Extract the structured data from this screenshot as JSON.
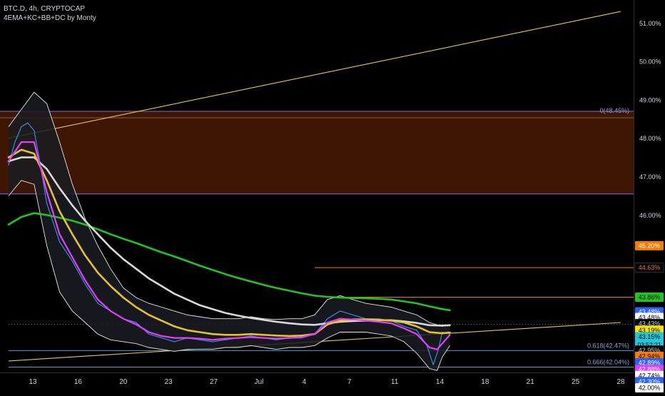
{
  "header": {
    "symbol_line": "BTC.D, 4h, CRYPTOCAP",
    "indicator_line": "4EMA+KC+BB+DC by Monty"
  },
  "colors": {
    "background": "#000000",
    "axis_text": "#d1d4dc",
    "ema_green": "#22c41e",
    "ema_white": "#d8d8d8",
    "ema_yellow": "#e6c229",
    "ema_magenta": "#e040fb",
    "trendline": "#e6c74a",
    "zone_fill": "#4a1a05",
    "zone_border": "#7c5cc4",
    "fib_line": "#5b9bd5",
    "orange_level": "#f57c00"
  },
  "chart_data": {
    "type": "line",
    "title": "BTC.D, 4h, CRYPTOCAP",
    "x_ticks": [
      "13",
      "16",
      "20",
      "23",
      "27",
      "Jul",
      "4",
      "7",
      "11",
      "14",
      "18",
      "21",
      "25",
      "28"
    ],
    "y_ticks": [
      "51.00%",
      "50.00%",
      "49.00%",
      "48.00%",
      "47.00%",
      "46.00%"
    ],
    "ylim": [
      41.9,
      51.6
    ],
    "y_unit": "%",
    "x_range_days": [
      0,
      48
    ],
    "series": [
      {
        "role": "price",
        "points": [
          [
            0,
            47.3
          ],
          [
            0.5,
            47.9
          ],
          [
            1,
            48.3
          ],
          [
            1.5,
            48.4
          ],
          [
            2,
            48.2
          ],
          [
            2.5,
            47.3
          ],
          [
            3,
            46.3
          ],
          [
            3.5,
            45.8
          ],
          [
            4,
            45.3
          ],
          [
            5,
            44.8
          ],
          [
            6,
            44.2
          ],
          [
            7,
            43.7
          ],
          [
            8,
            43.5
          ],
          [
            9,
            43.3
          ],
          [
            10,
            43.2
          ],
          [
            11,
            42.9
          ],
          [
            12,
            42.8
          ],
          [
            13,
            42.7
          ],
          [
            14,
            42.8
          ],
          [
            15,
            42.75
          ],
          [
            16,
            42.7
          ],
          [
            17,
            42.75
          ],
          [
            18,
            42.8
          ],
          [
            19,
            42.85
          ],
          [
            20,
            42.8
          ],
          [
            21,
            42.75
          ],
          [
            22,
            42.8
          ],
          [
            23,
            42.8
          ],
          [
            24,
            42.9
          ],
          [
            25,
            43.3
          ],
          [
            26,
            43.5
          ],
          [
            27,
            43.4
          ],
          [
            28,
            43.3
          ],
          [
            29,
            43.3
          ],
          [
            30,
            43.25
          ],
          [
            31,
            43.1
          ],
          [
            32,
            43.0
          ],
          [
            32.8,
            42.6
          ],
          [
            33.3,
            42.1
          ],
          [
            33.7,
            42.5
          ],
          [
            34,
            42.95
          ],
          [
            34.6,
            42.9
          ]
        ]
      },
      {
        "role": "ema-magenta",
        "points": [
          [
            0,
            47.4
          ],
          [
            1,
            47.9
          ],
          [
            2,
            47.9
          ],
          [
            3,
            46.6
          ],
          [
            4,
            45.5
          ],
          [
            5,
            44.9
          ],
          [
            6,
            44.3
          ],
          [
            7,
            43.8
          ],
          [
            8,
            43.5
          ],
          [
            9,
            43.3
          ],
          [
            10,
            43.15
          ],
          [
            11,
            42.95
          ],
          [
            12,
            42.85
          ],
          [
            13,
            42.8
          ],
          [
            14,
            42.8
          ],
          [
            15,
            42.78
          ],
          [
            16,
            42.75
          ],
          [
            17,
            42.78
          ],
          [
            18,
            42.8
          ],
          [
            19,
            42.82
          ],
          [
            20,
            42.8
          ],
          [
            21,
            42.78
          ],
          [
            22,
            42.8
          ],
          [
            23,
            42.82
          ],
          [
            24,
            42.9
          ],
          [
            25,
            43.2
          ],
          [
            26,
            43.3
          ],
          [
            27,
            43.28
          ],
          [
            28,
            43.25
          ],
          [
            29,
            43.22
          ],
          [
            30,
            43.18
          ],
          [
            31,
            43.05
          ],
          [
            32,
            42.9
          ],
          [
            33,
            42.55
          ],
          [
            33.6,
            42.5
          ],
          [
            34.6,
            42.88
          ]
        ]
      },
      {
        "role": "ema-yellow",
        "points": [
          [
            0,
            47.5
          ],
          [
            1,
            47.7
          ],
          [
            2,
            47.6
          ],
          [
            3,
            46.9
          ],
          [
            4,
            46.1
          ],
          [
            5,
            45.5
          ],
          [
            6,
            44.95
          ],
          [
            7,
            44.5
          ],
          [
            8,
            44.15
          ],
          [
            9,
            43.85
          ],
          [
            10,
            43.6
          ],
          [
            11,
            43.4
          ],
          [
            12,
            43.25
          ],
          [
            13,
            43.1
          ],
          [
            14,
            43.0
          ],
          [
            15,
            42.95
          ],
          [
            16,
            42.9
          ],
          [
            17,
            42.88
          ],
          [
            18,
            42.88
          ],
          [
            19,
            42.9
          ],
          [
            20,
            42.88
          ],
          [
            21,
            42.86
          ],
          [
            22,
            42.85
          ],
          [
            23,
            42.86
          ],
          [
            24,
            42.9
          ],
          [
            25,
            43.15
          ],
          [
            26,
            43.25
          ],
          [
            27,
            43.28
          ],
          [
            28,
            43.28
          ],
          [
            29,
            43.27
          ],
          [
            30,
            43.25
          ],
          [
            31,
            43.2
          ],
          [
            32,
            43.1
          ],
          [
            33,
            42.95
          ],
          [
            34,
            42.92
          ],
          [
            34.6,
            42.94
          ]
        ]
      },
      {
        "role": "ema-white",
        "points": [
          [
            0,
            47.4
          ],
          [
            1,
            47.5
          ],
          [
            2,
            47.5
          ],
          [
            3,
            47.2
          ],
          [
            4,
            46.7
          ],
          [
            5,
            46.25
          ],
          [
            6,
            45.85
          ],
          [
            7,
            45.5
          ],
          [
            8,
            45.15
          ],
          [
            9,
            44.85
          ],
          [
            10,
            44.6
          ],
          [
            11,
            44.35
          ],
          [
            12,
            44.15
          ],
          [
            13,
            43.95
          ],
          [
            14,
            43.8
          ],
          [
            15,
            43.65
          ],
          [
            16,
            43.55
          ],
          [
            17,
            43.45
          ],
          [
            18,
            43.38
          ],
          [
            19,
            43.32
          ],
          [
            20,
            43.27
          ],
          [
            21,
            43.22
          ],
          [
            22,
            43.18
          ],
          [
            23,
            43.15
          ],
          [
            24,
            43.14
          ],
          [
            25,
            43.18
          ],
          [
            26,
            43.22
          ],
          [
            27,
            43.24
          ],
          [
            28,
            43.25
          ],
          [
            29,
            43.26
          ],
          [
            30,
            43.26
          ],
          [
            31,
            43.23
          ],
          [
            32,
            43.19
          ],
          [
            33,
            43.13
          ],
          [
            34,
            43.12
          ],
          [
            34.6,
            43.13
          ]
        ]
      },
      {
        "role": "ema-green",
        "points": [
          [
            0,
            45.75
          ],
          [
            1,
            45.95
          ],
          [
            2,
            46.05
          ],
          [
            3,
            46.0
          ],
          [
            4,
            45.93
          ],
          [
            5,
            45.85
          ],
          [
            6,
            45.75
          ],
          [
            7,
            45.63
          ],
          [
            8,
            45.5
          ],
          [
            9,
            45.38
          ],
          [
            10,
            45.27
          ],
          [
            11,
            45.15
          ],
          [
            12,
            45.03
          ],
          [
            13,
            44.92
          ],
          [
            14,
            44.8
          ],
          [
            15,
            44.68
          ],
          [
            16,
            44.57
          ],
          [
            17,
            44.46
          ],
          [
            18,
            44.36
          ],
          [
            19,
            44.27
          ],
          [
            20,
            44.18
          ],
          [
            21,
            44.1
          ],
          [
            22,
            44.03
          ],
          [
            23,
            43.96
          ],
          [
            24,
            43.9
          ],
          [
            25,
            43.87
          ],
          [
            26,
            43.85
          ],
          [
            27,
            43.84
          ],
          [
            28,
            43.83
          ],
          [
            29,
            43.82
          ],
          [
            30,
            43.8
          ],
          [
            31,
            43.75
          ],
          [
            32,
            43.7
          ],
          [
            33,
            43.62
          ],
          [
            34,
            43.55
          ],
          [
            34.6,
            43.52
          ]
        ]
      },
      {
        "role": "bb-upper",
        "points": [
          [
            0,
            48.3
          ],
          [
            1,
            48.75
          ],
          [
            2,
            49.2
          ],
          [
            3,
            48.9
          ],
          [
            4,
            47.9
          ],
          [
            5,
            46.8
          ],
          [
            6,
            45.9
          ],
          [
            7,
            45.2
          ],
          [
            8,
            44.6
          ],
          [
            9,
            44.1
          ],
          [
            10,
            43.85
          ],
          [
            11,
            43.7
          ],
          [
            12,
            43.6
          ],
          [
            13,
            43.5
          ],
          [
            14,
            43.4
          ],
          [
            15,
            43.35
          ],
          [
            16,
            43.3
          ],
          [
            17,
            43.3
          ],
          [
            18,
            43.3
          ],
          [
            19,
            43.35
          ],
          [
            20,
            43.3
          ],
          [
            21,
            43.28
          ],
          [
            22,
            43.3
          ],
          [
            23,
            43.3
          ],
          [
            24,
            43.4
          ],
          [
            25,
            43.8
          ],
          [
            26,
            43.9
          ],
          [
            27,
            43.8
          ],
          [
            28,
            43.7
          ],
          [
            29,
            43.65
          ],
          [
            30,
            43.6
          ],
          [
            31,
            43.5
          ],
          [
            32,
            43.4
          ],
          [
            33,
            43.2
          ],
          [
            34,
            43.1
          ],
          [
            34.6,
            43.15
          ]
        ]
      },
      {
        "role": "bb-lower",
        "points": [
          [
            0,
            46.5
          ],
          [
            1,
            46.9
          ],
          [
            2,
            46.8
          ],
          [
            3,
            45.2
          ],
          [
            4,
            44.0
          ],
          [
            5,
            43.5
          ],
          [
            6,
            43.2
          ],
          [
            7,
            42.9
          ],
          [
            8,
            42.75
          ],
          [
            9,
            42.7
          ],
          [
            10,
            42.65
          ],
          [
            11,
            42.55
          ],
          [
            12,
            42.5
          ],
          [
            13,
            42.45
          ],
          [
            14,
            42.5
          ],
          [
            15,
            42.5
          ],
          [
            16,
            42.5
          ],
          [
            17,
            42.55
          ],
          [
            18,
            42.55
          ],
          [
            19,
            42.6
          ],
          [
            20,
            42.55
          ],
          [
            21,
            42.5
          ],
          [
            22,
            42.55
          ],
          [
            23,
            42.55
          ],
          [
            24,
            42.6
          ],
          [
            25,
            42.8
          ],
          [
            26,
            42.95
          ],
          [
            27,
            42.95
          ],
          [
            28,
            42.95
          ],
          [
            29,
            42.9
          ],
          [
            30,
            42.85
          ],
          [
            31,
            42.7
          ],
          [
            32,
            42.4
          ],
          [
            33,
            42.0
          ],
          [
            33.6,
            41.95
          ],
          [
            34,
            42.3
          ],
          [
            34.6,
            42.6
          ]
        ]
      }
    ],
    "zone": {
      "top": 48.7,
      "bottom": 46.55,
      "label": "0(48.45%)"
    },
    "trendlines": [
      {
        "points": [
          [
            0,
            48.0
          ],
          [
            48,
            51.3
          ]
        ]
      },
      {
        "points": [
          [
            0,
            42.2
          ],
          [
            48,
            43.2
          ]
        ]
      }
    ],
    "horizontal_levels": [
      {
        "value": 44.63,
        "x_start": 24,
        "style": "orange"
      },
      {
        "value": 43.86,
        "x_start": 25,
        "style": "orange"
      },
      {
        "value": 42.47,
        "x_start": 0,
        "style": "fib",
        "label": "0.618(42.47%)"
      },
      {
        "value": 42.04,
        "x_start": 0,
        "style": "fib",
        "label": "0.666(42.04%)"
      },
      {
        "value": 43.15,
        "x_start": 0,
        "style": "dotted"
      }
    ],
    "price_badges": [
      {
        "text": "45.20%",
        "value": 45.2,
        "bg": "#f57c00",
        "fg": "#ffffff"
      },
      {
        "text": "44.63%",
        "value": 44.63,
        "bg": "#000000",
        "fg": "#f57c00"
      },
      {
        "text": "43.86%",
        "value": 43.86,
        "bg": "#22c41e",
        "fg": "#000000"
      },
      {
        "text": "43.48%",
        "value": 43.48,
        "bg": "#2962ff",
        "fg": "#ffffff"
      },
      {
        "text": "43.48%",
        "value": 43.33,
        "bg": "#ffffff",
        "fg": "#000000"
      },
      {
        "text": "43.43%",
        "value": 43.17,
        "bg": "#000000",
        "fg": "#d1d4dc"
      },
      {
        "text": "43.19%",
        "value": 43.0,
        "bg": "#f5e400",
        "fg": "#000000"
      },
      {
        "text": "43.15%",
        "value": 42.83,
        "bg": "#26c6da",
        "fg": "#000000",
        "sub": "03:52:21"
      },
      {
        "text": "42.95%",
        "value": 42.48,
        "bg": "#000000",
        "fg": "#d1d4dc"
      },
      {
        "text": "42.94%",
        "value": 42.32,
        "bg": "#f57c00",
        "fg": "#000000"
      },
      {
        "text": "42.89%",
        "value": 42.15,
        "bg": "#2962ff",
        "fg": "#ffffff"
      },
      {
        "text": "42.88%",
        "value": 41.98,
        "bg": "#e040fb",
        "fg": "#ffffff"
      },
      {
        "text": "42.74%",
        "value": 41.82,
        "bg": "#ffffff",
        "fg": "#000000"
      },
      {
        "text": "42.30%",
        "value": 41.66,
        "bg": "#2962ff",
        "fg": "#ffffff"
      },
      {
        "text": "42.00%",
        "value": 41.5,
        "bg": "#ffffff",
        "fg": "#000000"
      }
    ]
  }
}
